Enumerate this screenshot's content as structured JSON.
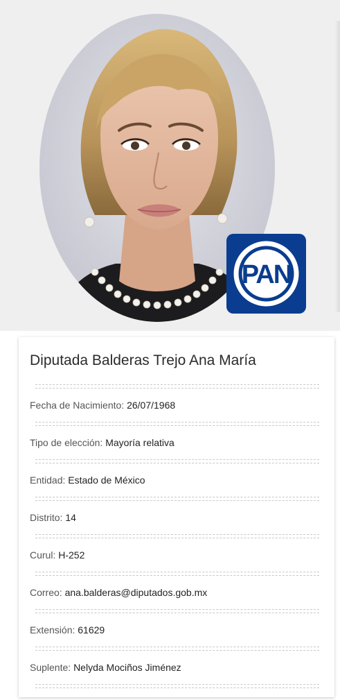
{
  "profile": {
    "title": "Diputada Balderas Trejo Ana María",
    "party_logo_text": "PAN",
    "colors": {
      "party_blue": "#0a3d8f",
      "band_bg": "#efefef"
    }
  },
  "fields": [
    {
      "label": "Fecha de Nacimiento: ",
      "value": "26/07/1968"
    },
    {
      "label": "Tipo de elección: ",
      "value": "Mayoría relativa"
    },
    {
      "label": "Entidad: ",
      "value": "Estado de México"
    },
    {
      "label": "Distrito: ",
      "value": "14"
    },
    {
      "label": "Curul: ",
      "value": "H-252"
    },
    {
      "label": "Correo: ",
      "value": "ana.balderas@diputados.gob.mx"
    },
    {
      "label": "Extensión: ",
      "value": "61629"
    },
    {
      "label": "Suplente: ",
      "value": "Nelyda Mociños Jiménez"
    }
  ]
}
